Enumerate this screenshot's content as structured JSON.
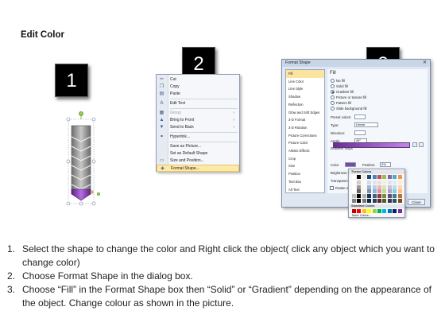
{
  "title": "Edit Color",
  "step_badges": [
    "1",
    "2",
    "3"
  ],
  "context_menu": {
    "items": [
      {
        "label": "Cut",
        "icon": "scissors-icon",
        "glyph": "✂"
      },
      {
        "label": "Copy",
        "icon": "copy-icon",
        "glyph": "❐"
      },
      {
        "label": "Paste",
        "icon": "paste-icon",
        "glyph": "▤"
      },
      {
        "label": "Edit Text",
        "icon": "edit-text-icon",
        "glyph": "A"
      },
      {
        "label": "Group",
        "icon": "group-icon",
        "glyph": "▦"
      },
      {
        "label": "Bring to Front",
        "icon": "bring-front-icon",
        "glyph": "▲"
      },
      {
        "label": "Send to Back",
        "icon": "send-back-icon",
        "glyph": "▼"
      },
      {
        "label": "Hyperlink...",
        "icon": "hyperlink-icon",
        "glyph": "⚭"
      },
      {
        "label": "Save as Picture...",
        "icon": "",
        "glyph": ""
      },
      {
        "label": "Set as Default Shape",
        "icon": "",
        "glyph": ""
      },
      {
        "label": "Size and Position...",
        "icon": "size-position-icon",
        "glyph": "▭"
      },
      {
        "label": "Format Shape...",
        "icon": "format-shape-icon",
        "glyph": "◈"
      }
    ]
  },
  "dialog": {
    "title": "Format Shape",
    "close_glyph": "✕",
    "categories": [
      "Fill",
      "Line Color",
      "Line Style",
      "Shadow",
      "Reflection",
      "Glow and Soft Edges",
      "3-D Format",
      "3-D Rotation",
      "Picture Corrections",
      "Picture Color",
      "Artistic Effects",
      "Crop",
      "Size",
      "Position",
      "Text Box",
      "Alt Text"
    ],
    "section": "Fill",
    "options": [
      "No fill",
      "Solid fill",
      "Gradient fill",
      "Picture or texture fill",
      "Pattern fill",
      "Slide background fill"
    ],
    "selected_option": "Gradient fill",
    "labels": {
      "preset": "Preset colors:",
      "type": "Type:",
      "type_value": "Linear",
      "direction": "Direction:",
      "angle": "Angle:",
      "angle_value": "45°",
      "gradient_stops": "Gradient stops",
      "color": "Color",
      "position": "Position:",
      "position_value": "0%",
      "brightness": "Brightness:",
      "transparency": "Transparency:",
      "rotate": "Rotate with shape"
    },
    "close_label": "Close"
  },
  "color_popup": {
    "theme_header": "Theme Colors",
    "standard_header": "Standard Colors",
    "more": "More Colors...",
    "theme_top": [
      "#ffffff",
      "#000000",
      "#eeece1",
      "#1f497d",
      "#4f81bd",
      "#c0504d",
      "#9bbb59",
      "#8064a2",
      "#4bacc6",
      "#f79646"
    ],
    "standard": [
      "#c00000",
      "#ff0000",
      "#ffc000",
      "#ffff00",
      "#92d050",
      "#00b050",
      "#00b0f0",
      "#0070c0",
      "#002060",
      "#7030a0"
    ]
  },
  "instructions": [
    {
      "n": "1.",
      "text": "Select the shape to change the color and Right click the object( click any object which you want to change color)"
    },
    {
      "n": "2.",
      "text": "Choose Format Shape in the dialog box."
    },
    {
      "n": "3.",
      "text": "Choose “Fill” in the Format Shape box then “Solid” or “Gradient” depending on the appearance of the object. Change colour as shown in the picture."
    }
  ]
}
